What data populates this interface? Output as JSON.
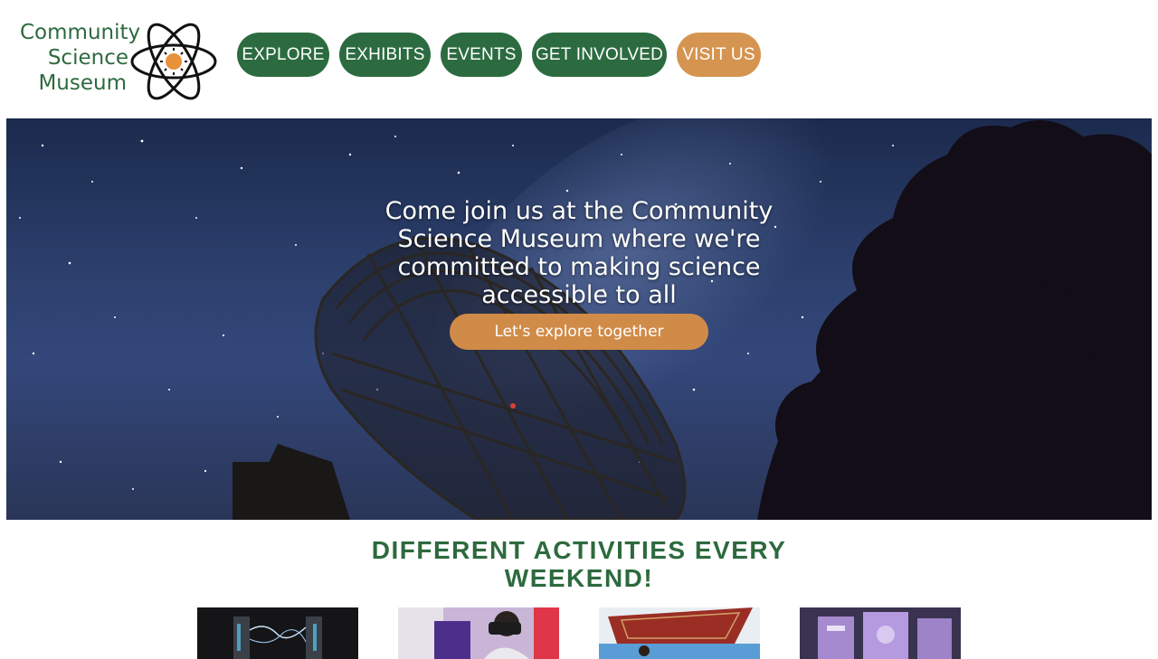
{
  "logo": {
    "line1": "Community",
    "line2": "Science",
    "line3": "Museum",
    "icon": "atom-icon"
  },
  "nav": {
    "items": [
      {
        "label": "EXPLORE"
      },
      {
        "label": "EXHIBITS"
      },
      {
        "label": "EVENTS"
      },
      {
        "label": "GET INVOLVED"
      },
      {
        "label": "VISIT US"
      }
    ]
  },
  "hero": {
    "headline": "Come join us at the Community Science Museum where we're committed to making science accessible to all",
    "cta_label": "Let's explore together"
  },
  "activities": {
    "title": "DIFFERENT ACTIVITIES EVERY WEEKEND!",
    "thumbnails": [
      {
        "icon": "electric-arc-image"
      },
      {
        "icon": "vr-headset-image"
      },
      {
        "icon": "rug-experiment-image"
      },
      {
        "icon": "lab-machine-image"
      }
    ]
  },
  "colors": {
    "brand_green": "#2c6b40",
    "accent_orange": "#d59450"
  }
}
